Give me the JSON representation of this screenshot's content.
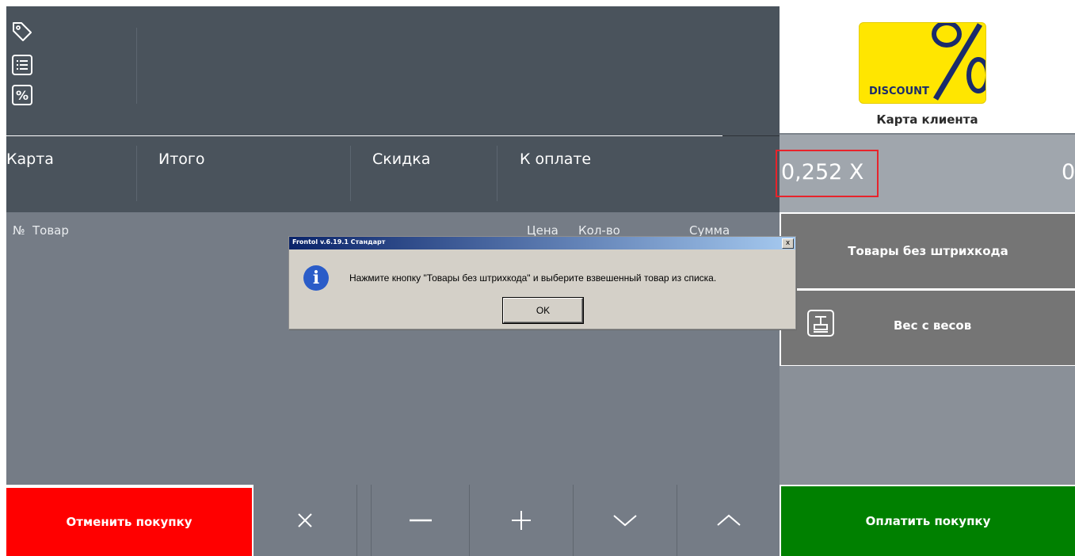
{
  "header": {
    "icons": [
      "tag-icon",
      "list-icon",
      "percent-icon"
    ]
  },
  "totals": {
    "card": "Карта",
    "total": "Итого",
    "discount": "Скидка",
    "to_pay": "К оплате"
  },
  "list": {
    "columns": {
      "number": "№",
      "product": "Товар",
      "price": "Цена",
      "quantity": "Кол-во",
      "sum": "Сумма"
    }
  },
  "bottom": {
    "cancel_label": "Отменить покупку",
    "controls": [
      "close-icon",
      "minus-icon",
      "plus-icon",
      "chevron-down-icon",
      "chevron-up-icon"
    ]
  },
  "right_panel": {
    "discount_logo_text": "DISCOUNT",
    "card_label": "Карта клиента",
    "quantity_display": "0,252 X",
    "amount_display": "0",
    "no_barcode_label": "Товары без штрихкода",
    "scale_label": "Вес с весов",
    "pay_label": "Оплатить покупку"
  },
  "dialog": {
    "title": "Frontol v.6.19.1 Стандарт",
    "close": "x",
    "icon": "info-icon",
    "message": "Нажмите кнопку \"Товары без штрихкода\" и выберите взвешенный товар из списка.",
    "ok_label": "OK"
  },
  "colors": {
    "cancel": "#ff0000",
    "pay": "#008000",
    "highlight": "#e8232b",
    "discount_logo": "#ffe600"
  }
}
